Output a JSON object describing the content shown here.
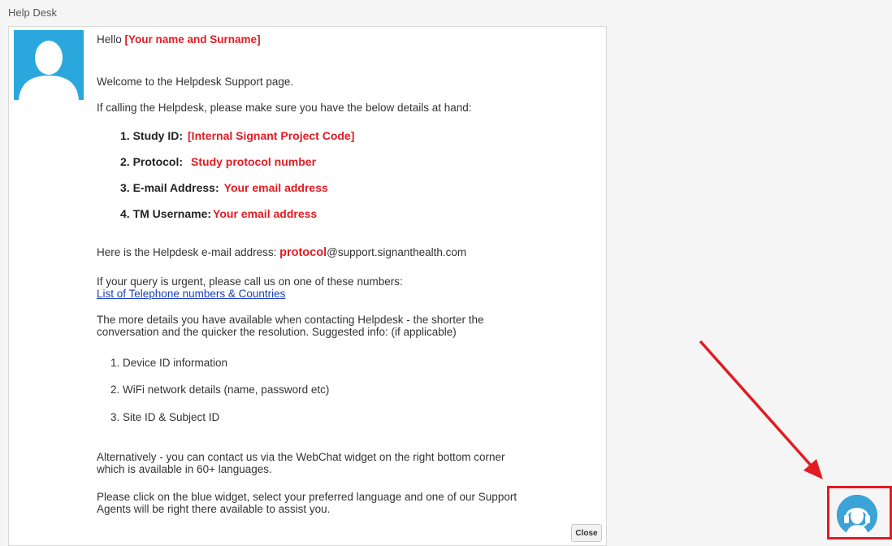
{
  "window": {
    "title": "Help Desk"
  },
  "greeting": {
    "hello": "Hello",
    "name_placeholder": "[Your name and Surname]"
  },
  "welcome_text": "Welcome to the Helpdesk Support page.",
  "calling_text": "If calling the Helpdesk, please make sure you have the below details at hand:",
  "details": [
    {
      "label": "1. Study ID:",
      "value": "[Internal Signant Project Code]"
    },
    {
      "label": "2. Protocol:",
      "value": "Study protocol number"
    },
    {
      "label": "3. E-mail Address:",
      "value": "Your email address"
    },
    {
      "label": "4. TM Username:",
      "value": "Your email address"
    }
  ],
  "email_line": {
    "prefix": "Here is the Helpdesk e-mail address:",
    "highlight": "protocol",
    "domain": "@support.signanthealth.com"
  },
  "urgent_text": "If your query is urgent, please call us on one of these numbers:",
  "phone_link": "List of Telephone numbers & Countries",
  "more_details_1": "The more details you have available when contacting Helpdesk - the shorter the",
  "more_details_2": "conversation and the quicker the resolution. Suggested info: (if applicable)",
  "suggested": [
    "1. Device ID information",
    "2. WiFi network details (name, password etc)",
    "3. Site ID & Subject ID"
  ],
  "webchat_1": "Alternatively - you can contact us via the WebChat widget on the right bottom corner",
  "webchat_2": "which is available in 60+ languages.",
  "widget_1": "Please click on the blue widget, select your preferred language and one of our Support",
  "widget_2": "Agents will be right there available to assist you.",
  "close_button": "Close",
  "icons": {
    "avatar": "user-silhouette-icon",
    "widget": "support-agent-icon",
    "arrow": "red-arrow-annotation"
  },
  "colors": {
    "highlight_red": "#e21b23",
    "link_blue": "#1a3fb4",
    "avatar_blue": "#2aa8de",
    "widget_blue": "#3ba3d6"
  }
}
